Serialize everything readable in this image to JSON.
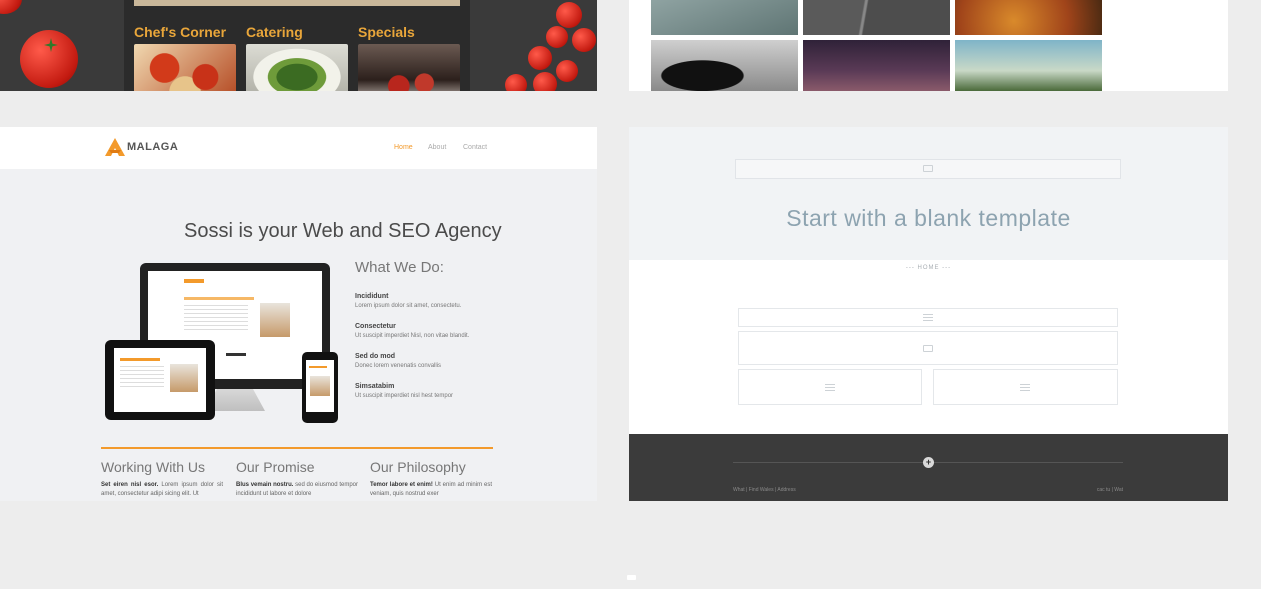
{
  "restaurant": {
    "columns": [
      {
        "title": "Chef's Corner",
        "image": "pasta-dish-image"
      },
      {
        "title": "Catering",
        "image": "salad-bowl-image"
      },
      {
        "title": "Specials",
        "image": "dining-table-image"
      }
    ]
  },
  "gallery": {
    "tiles": [
      "road-sign-photo",
      "highway-photo",
      "autumn-leaves-photo",
      "shoe-bw-photo",
      "purple-sky-photo",
      "palm-trees-photo"
    ]
  },
  "malaga": {
    "brand": "MALAGA",
    "nav": [
      "Home",
      "About",
      "Contact"
    ],
    "active_nav": "Home",
    "headline": "Sossi is your Web and SEO Agency",
    "what_we_do": "What We Do:",
    "services": [
      {
        "title": "Incididunt",
        "desc": "Lorem ipsum dolor sit amet, consectetu."
      },
      {
        "title": "Consectetur",
        "desc": "Ut suscipit imperdiet Nisl, non vitae blandit."
      },
      {
        "title": "Sed do mod",
        "desc": "Donec lorem venenatis convallis"
      },
      {
        "title": "Simsatabim",
        "desc": "Ut suscipit imperdiet nisl hest tempor"
      }
    ],
    "columns": [
      {
        "heading": "Working With Us",
        "bold": "Set eiren nisl esor.",
        "text": "Lorem ipsum dolor sit amet, consectetur adipi sicing elit. Ut"
      },
      {
        "heading": "Our Promise",
        "bold": "Blus vemain nostru.",
        "text": "sed do eiusmod tempor incididunt ut labore et dolore"
      },
      {
        "heading": "Our Philosophy",
        "bold": "Temor labore et enim!",
        "text": "Ut enim ad minim est veniam, quis nostrud exer"
      }
    ],
    "colors": {
      "accent": "#f39a2b"
    }
  },
  "blank": {
    "title": "Start with a blank template",
    "home_label": "--- HOME ---",
    "footer_left": "What | Find Wales | Address",
    "footer_right": "cac tu | Wat"
  }
}
